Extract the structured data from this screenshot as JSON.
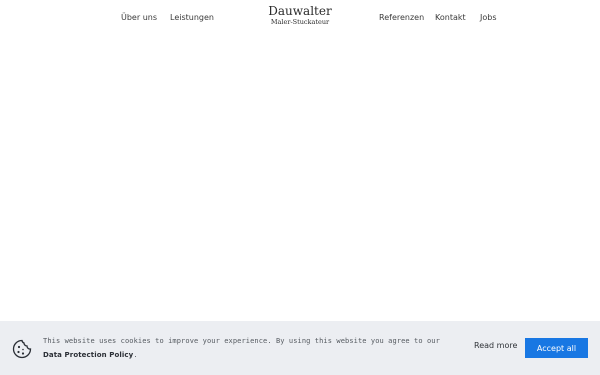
{
  "nav": {
    "left_items": [
      "Über uns",
      "Leistungen"
    ],
    "right_items": [
      "Referenzen",
      "Kontakt",
      "Jobs"
    ],
    "logo": {
      "name": "Dauwalter",
      "subtitle": "Maler-Stuckateur"
    }
  },
  "cookie": {
    "icon": "cookie-icon",
    "text_before_link": "This website uses cookies to improve your experience. By using this website you agree to our ",
    "link": "Data Protection Policy",
    "text_after_link": ".",
    "read_more": "Read more",
    "accept": "Accept all",
    "colors": {
      "bar": "#eceef2",
      "accept_button": "#1877e3"
    }
  }
}
